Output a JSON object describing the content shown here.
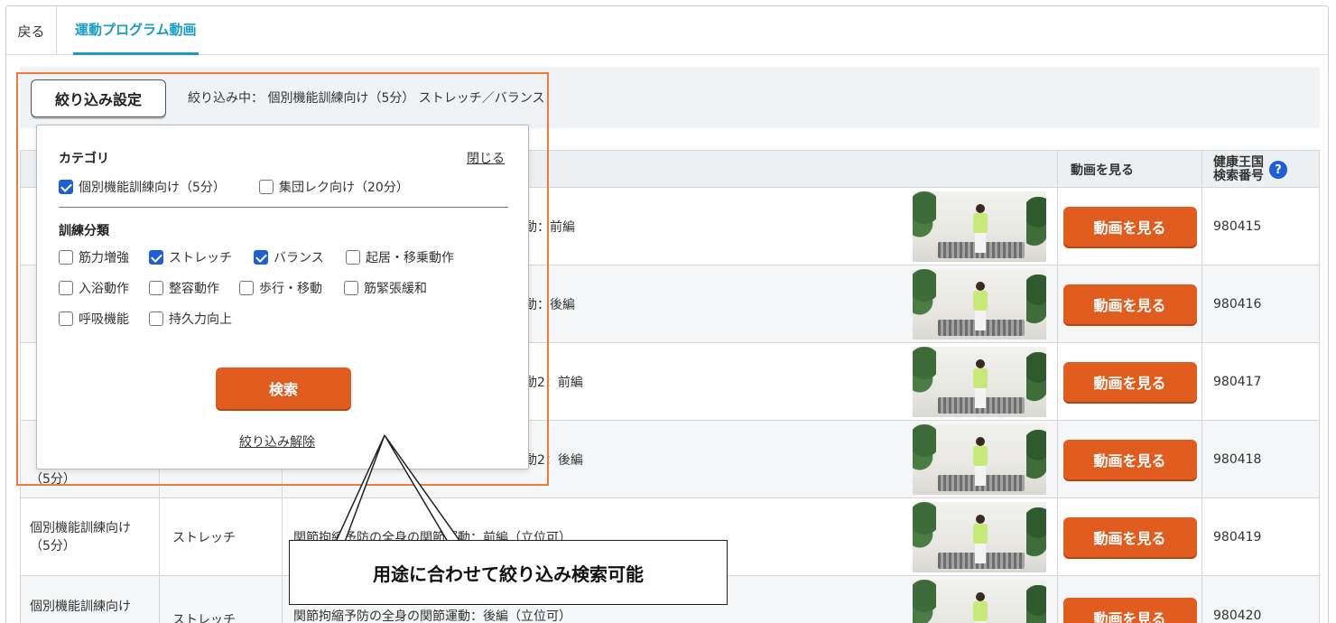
{
  "header": {
    "back_label": "戻る",
    "active_tab": "運動プログラム動画"
  },
  "filter": {
    "button_label": "絞り込み設定",
    "status_text": "絞り込み中： 個別機能訓練向け（5分） ストレッチ／バランス"
  },
  "table": {
    "col_watch": "動画を見る",
    "col_num_line1": "健康王国",
    "col_num_line2": "検索番号",
    "help_glyph": "?",
    "rows": [
      {
        "category": "",
        "type": "",
        "title": "動：前編",
        "button": "動画を見る",
        "number": "980415"
      },
      {
        "category": "",
        "type": "",
        "title": "動：後編",
        "button": "動画を見る",
        "number": "980416"
      },
      {
        "category": "",
        "type": "",
        "title": "動2：前編",
        "button": "動画を見る",
        "number": "980417"
      },
      {
        "category": "（5分）",
        "type": "",
        "title": "動2：後編",
        "button": "動画を見る",
        "number": "980418"
      },
      {
        "category": "個別機能訓練向け（5分）",
        "type": "ストレッチ",
        "title": "関節拘縮予防の全身の関節運動：前編（立位可）",
        "button": "動画を見る",
        "number": "980419"
      },
      {
        "category": "個別機能訓練向け",
        "type": "ストレッチ",
        "title": "関節拘縮予防の全身の関節運動：後編（立位可）",
        "button": "動画を見る",
        "number": "980420"
      }
    ]
  },
  "popup": {
    "category_heading": "カテゴリ",
    "close_label": "閉じる",
    "categories": [
      {
        "label": "個別機能訓練向け（5分）",
        "checked": true
      },
      {
        "label": "集団レク向け（20分）",
        "checked": false
      }
    ],
    "training_heading": "訓練分類",
    "trainings": [
      {
        "label": "筋力増強",
        "checked": false
      },
      {
        "label": "ストレッチ",
        "checked": true
      },
      {
        "label": "バランス",
        "checked": true
      },
      {
        "label": "起居・移乗動作",
        "checked": false
      },
      {
        "label": "入浴動作",
        "checked": false
      },
      {
        "label": "整容動作",
        "checked": false
      },
      {
        "label": "歩行・移動",
        "checked": false
      },
      {
        "label": "筋緊張緩和",
        "checked": false
      },
      {
        "label": "呼吸機能",
        "checked": false
      },
      {
        "label": "持久力向上",
        "checked": false
      }
    ],
    "search_label": "検索",
    "clear_label": "絞り込み解除"
  },
  "annotation": {
    "callout_text": "用途に合わせて絞り込み検索可能"
  },
  "colors": {
    "accent_orange": "#e15c1f",
    "tab_blue": "#1a9bc4",
    "check_blue": "#1e5fd6",
    "highlight_orange": "#ef7a3a"
  }
}
